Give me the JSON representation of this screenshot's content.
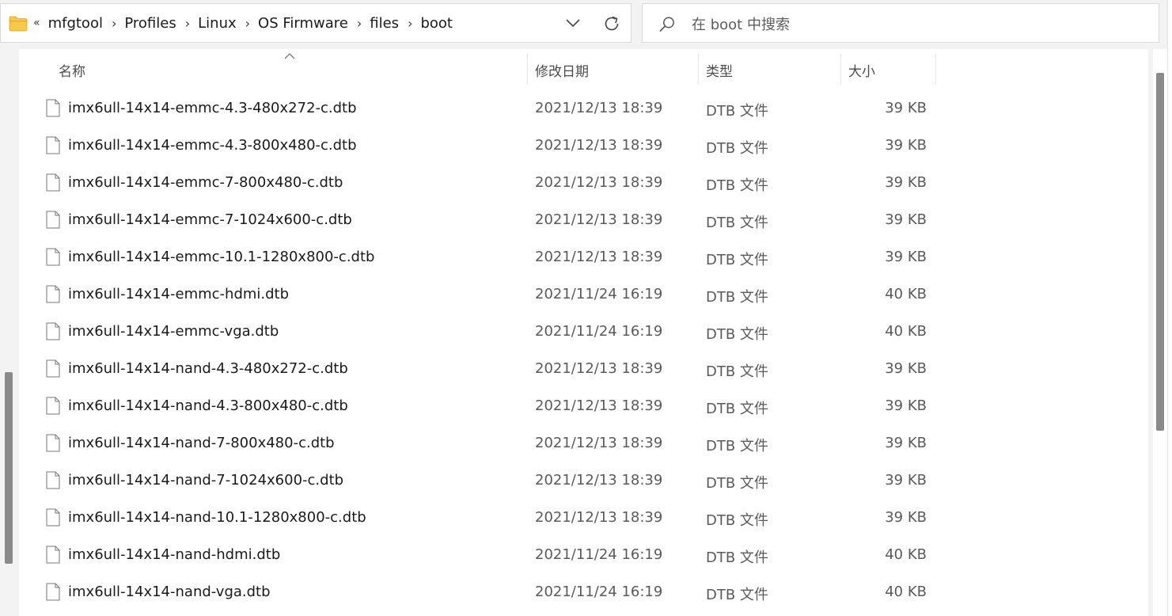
{
  "address_bar": {
    "overflow_label": "«",
    "breadcrumbs": [
      "mfgtool",
      "Profiles",
      "Linux",
      "OS Firmware",
      "files",
      "boot"
    ]
  },
  "search": {
    "placeholder": "在 boot 中搜索"
  },
  "columns": {
    "name": "名称",
    "date": "修改日期",
    "type": "类型",
    "size": "大小"
  },
  "files": [
    {
      "name": "imx6ull-14x14-emmc-4.3-480x272-c.dtb",
      "date": "2021/12/13 18:39",
      "type": "DTB 文件",
      "size": "39 KB"
    },
    {
      "name": "imx6ull-14x14-emmc-4.3-800x480-c.dtb",
      "date": "2021/12/13 18:39",
      "type": "DTB 文件",
      "size": "39 KB"
    },
    {
      "name": "imx6ull-14x14-emmc-7-800x480-c.dtb",
      "date": "2021/12/13 18:39",
      "type": "DTB 文件",
      "size": "39 KB"
    },
    {
      "name": "imx6ull-14x14-emmc-7-1024x600-c.dtb",
      "date": "2021/12/13 18:39",
      "type": "DTB 文件",
      "size": "39 KB"
    },
    {
      "name": "imx6ull-14x14-emmc-10.1-1280x800-c.dtb",
      "date": "2021/12/13 18:39",
      "type": "DTB 文件",
      "size": "39 KB"
    },
    {
      "name": "imx6ull-14x14-emmc-hdmi.dtb",
      "date": "2021/11/24 16:19",
      "type": "DTB 文件",
      "size": "40 KB"
    },
    {
      "name": "imx6ull-14x14-emmc-vga.dtb",
      "date": "2021/11/24 16:19",
      "type": "DTB 文件",
      "size": "40 KB"
    },
    {
      "name": "imx6ull-14x14-nand-4.3-480x272-c.dtb",
      "date": "2021/12/13 18:39",
      "type": "DTB 文件",
      "size": "39 KB"
    },
    {
      "name": "imx6ull-14x14-nand-4.3-800x480-c.dtb",
      "date": "2021/12/13 18:39",
      "type": "DTB 文件",
      "size": "39 KB"
    },
    {
      "name": "imx6ull-14x14-nand-7-800x480-c.dtb",
      "date": "2021/12/13 18:39",
      "type": "DTB 文件",
      "size": "39 KB"
    },
    {
      "name": "imx6ull-14x14-nand-7-1024x600-c.dtb",
      "date": "2021/12/13 18:39",
      "type": "DTB 文件",
      "size": "39 KB"
    },
    {
      "name": "imx6ull-14x14-nand-10.1-1280x800-c.dtb",
      "date": "2021/12/13 18:39",
      "type": "DTB 文件",
      "size": "39 KB"
    },
    {
      "name": "imx6ull-14x14-nand-hdmi.dtb",
      "date": "2021/11/24 16:19",
      "type": "DTB 文件",
      "size": "40 KB"
    },
    {
      "name": "imx6ull-14x14-nand-vga.dtb",
      "date": "2021/11/24 16:19",
      "type": "DTB 文件",
      "size": "40 KB"
    }
  ],
  "icons": {
    "location": "folder-icon",
    "file": "document-icon",
    "dropdown": "chevron-down-icon",
    "refresh": "refresh-icon",
    "search": "search-icon",
    "sort": "sort-ascending-icon"
  },
  "colors": {
    "folder": "#f8c848",
    "scrollbar": "#8a8a8a"
  }
}
